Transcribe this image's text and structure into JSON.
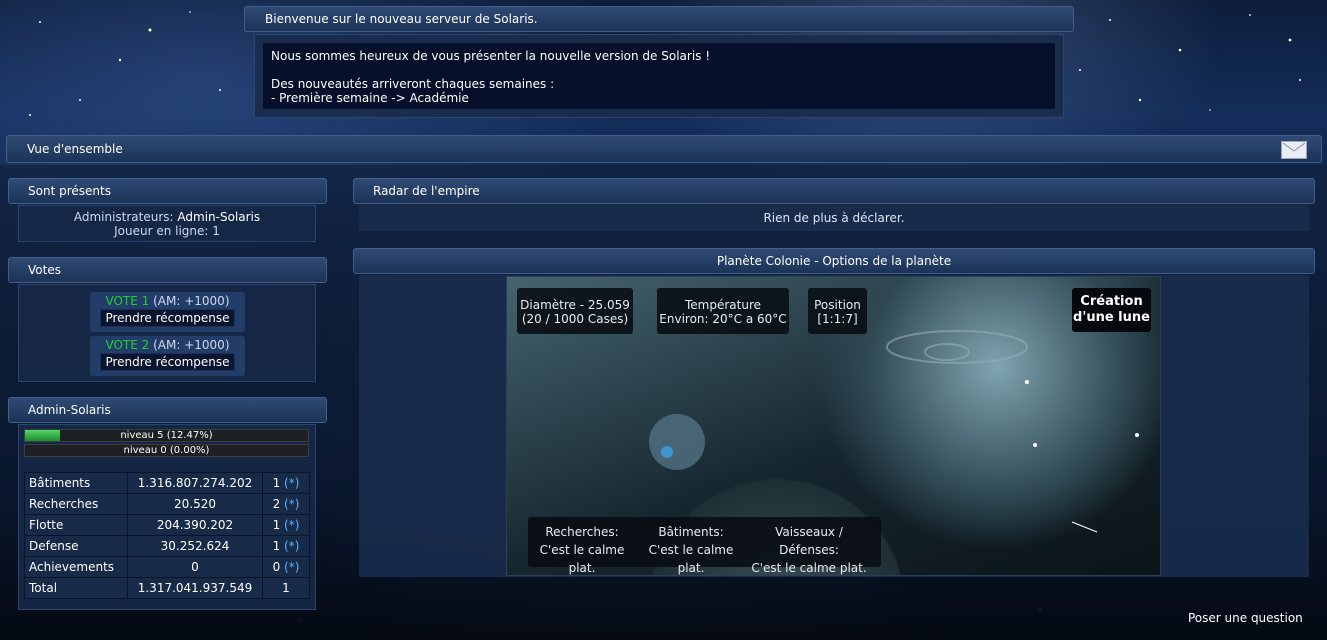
{
  "welcome": {
    "title": "Bienvenue sur le nouveau serveur de Solaris.",
    "line1": "Nous sommes heureux de vous présenter la nouvelle version de Solaris !",
    "line2": "Des nouveautés arriveront chaques semaines :",
    "line3": "- Première semaine -> Académie"
  },
  "overview": {
    "title": "Vue d'ensemble",
    "mail_icon": "envelope-icon"
  },
  "present": {
    "title": "Sont présents",
    "admins_label": "Administrateurs:",
    "admins_value": "Admin-Solaris",
    "online": "Joueur en ligne: 1"
  },
  "votes": {
    "title": "Votes",
    "items": [
      {
        "label": "VOTE 1",
        "bonus": "(AM: +1000)",
        "button": "Prendre récompense"
      },
      {
        "label": "VOTE 2",
        "bonus": "(AM: +1000)",
        "button": "Prendre récompense"
      }
    ]
  },
  "player": {
    "title": "Admin-Solaris",
    "levels": [
      {
        "text": "niveau 5 (12.47%)",
        "progress": 0.1247
      },
      {
        "text": "niveau 0 (0.00%)",
        "progress": 0.0
      }
    ],
    "stats": [
      {
        "name": "Bâtiments",
        "value": "1.316.807.274.202",
        "rank": "1",
        "star": "(*)"
      },
      {
        "name": "Recherches",
        "value": "20.520",
        "rank": "2",
        "star": "(*)"
      },
      {
        "name": "Flotte",
        "value": "204.390.202",
        "rank": "1",
        "star": "(*)"
      },
      {
        "name": "Defense",
        "value": "30.252.624",
        "rank": "1",
        "star": "(*)"
      },
      {
        "name": "Achievements",
        "value": "0",
        "rank": "0",
        "star": "(*)"
      },
      {
        "name": "Total",
        "value": "1.317.041.937.549",
        "rank": "1",
        "star": ""
      }
    ]
  },
  "radar": {
    "title": "Radar de l'empire",
    "message": "Rien de plus à déclarer."
  },
  "planet": {
    "title": "Planète Colonie - Options de la planète",
    "diameter_l1": "Diamètre - 25.059",
    "diameter_l2": "(20 / 1000 Cases)",
    "temp_l1": "Température",
    "temp_l2": "Environ: 20°C a 60°C",
    "pos_l1": "Position",
    "pos_l2": "[1:1:7]",
    "moon_l1": "Création",
    "moon_l2": "d'une lune",
    "research_l1": "Recherches:",
    "research_l2": "C'est le calme plat.",
    "buildings_l1": "Bâtiments:",
    "buildings_l2": "C'est le calme plat.",
    "ships_l1": "Vaisseaux / Défenses:",
    "ships_l2": "C'est le calme plat."
  },
  "footer": {
    "ask": "Poser une question"
  }
}
